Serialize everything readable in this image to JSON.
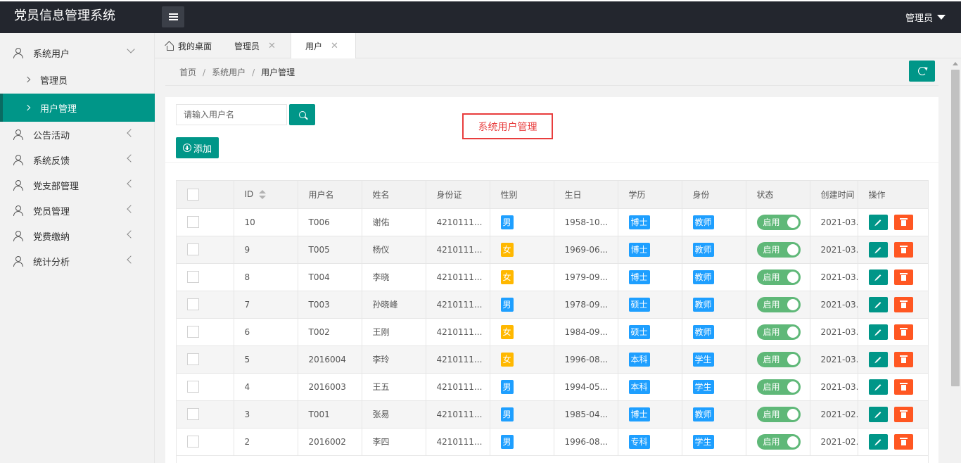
{
  "header": {
    "app_title": "党员信息管理系统",
    "user_label": "管理员"
  },
  "sidebar": {
    "items": [
      {
        "label": "系统用户",
        "expanded": true,
        "sub": [
          {
            "label": "管理员",
            "active": false
          },
          {
            "label": "用户管理",
            "active": true
          }
        ]
      },
      {
        "label": "公告活动"
      },
      {
        "label": "系统反馈"
      },
      {
        "label": "党支部管理"
      },
      {
        "label": "党员管理"
      },
      {
        "label": "党费缴纳"
      },
      {
        "label": "统计分析"
      }
    ]
  },
  "tabs": [
    {
      "label": "我的桌面",
      "icon": "home-icon",
      "closable": false
    },
    {
      "label": "管理员",
      "closable": true
    },
    {
      "label": "用户",
      "closable": true,
      "active": true
    }
  ],
  "breadcrumb": [
    "首页",
    "系统用户",
    "用户管理"
  ],
  "search": {
    "placeholder": "请输入用户名",
    "value": ""
  },
  "page_title_box": "系统用户管理",
  "add_button": "添加",
  "colors": {
    "accent": "#009688",
    "male": "#1e9fff",
    "female": "#ffb800",
    "switch_on": "#5fb878",
    "delete": "#ff5722",
    "title_border": "#e83d3d"
  },
  "table": {
    "columns": [
      "",
      "ID",
      "用户名",
      "姓名",
      "身份证",
      "性别",
      "生日",
      "学历",
      "身份",
      "状态",
      "创建时间",
      "操作"
    ],
    "rows": [
      {
        "id": "10",
        "username": "T006",
        "name": "谢佑",
        "idcard": "4210111...",
        "gender": "男",
        "birthday": "1958-10...",
        "edu": "博士",
        "role": "教师",
        "status": "启用",
        "created": "2021-03..."
      },
      {
        "id": "9",
        "username": "T005",
        "name": "杨仪",
        "idcard": "4210111...",
        "gender": "女",
        "birthday": "1969-06...",
        "edu": "博士",
        "role": "教师",
        "status": "启用",
        "created": "2021-03..."
      },
      {
        "id": "8",
        "username": "T004",
        "name": "李晓",
        "idcard": "4210111...",
        "gender": "女",
        "birthday": "1979-09...",
        "edu": "博士",
        "role": "教师",
        "status": "启用",
        "created": "2021-03..."
      },
      {
        "id": "7",
        "username": "T003",
        "name": "孙晓峰",
        "idcard": "4210111...",
        "gender": "男",
        "birthday": "1978-09...",
        "edu": "硕士",
        "role": "教师",
        "status": "启用",
        "created": "2021-03..."
      },
      {
        "id": "6",
        "username": "T002",
        "name": "王刚",
        "idcard": "4210111...",
        "gender": "女",
        "birthday": "1984-09...",
        "edu": "硕士",
        "role": "教师",
        "status": "启用",
        "created": "2021-03..."
      },
      {
        "id": "5",
        "username": "2016004",
        "name": "李玲",
        "idcard": "4210111...",
        "gender": "女",
        "birthday": "1996-08...",
        "edu": "本科",
        "role": "学生",
        "status": "启用",
        "created": "2021-03..."
      },
      {
        "id": "4",
        "username": "2016003",
        "name": "王五",
        "idcard": "4210111...",
        "gender": "男",
        "birthday": "1994-05...",
        "edu": "本科",
        "role": "学生",
        "status": "启用",
        "created": "2021-03..."
      },
      {
        "id": "3",
        "username": "T001",
        "name": "张易",
        "idcard": "4210111...",
        "gender": "男",
        "birthday": "1985-04...",
        "edu": "博士",
        "role": "教师",
        "status": "启用",
        "created": "2021-02..."
      },
      {
        "id": "2",
        "username": "2016002",
        "name": "李四",
        "idcard": "4210111...",
        "gender": "男",
        "birthday": "1996-08...",
        "edu": "专科",
        "role": "学生",
        "status": "启用",
        "created": "2021-02..."
      }
    ]
  }
}
